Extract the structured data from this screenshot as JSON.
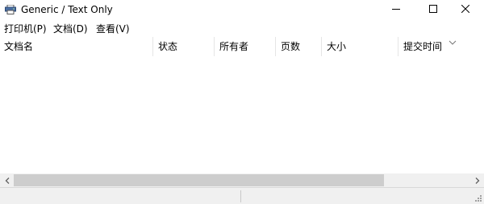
{
  "window": {
    "title": "Generic / Text Only",
    "icon": "printer-icon"
  },
  "menu": {
    "items": [
      "打印机(P)",
      "文档(D)",
      "查看(V)"
    ]
  },
  "columns": [
    "文档名",
    "状态",
    "所有者",
    "页数",
    "大小",
    "提交时间"
  ],
  "status": {
    "panes": [
      "",
      "",
      ""
    ]
  },
  "colors": {
    "window_bg": "#ffffff",
    "scrollbar_track": "#f0f0f0",
    "scrollbar_thumb": "#cdcdcd",
    "statusbar_bg": "#f0f0f0"
  }
}
